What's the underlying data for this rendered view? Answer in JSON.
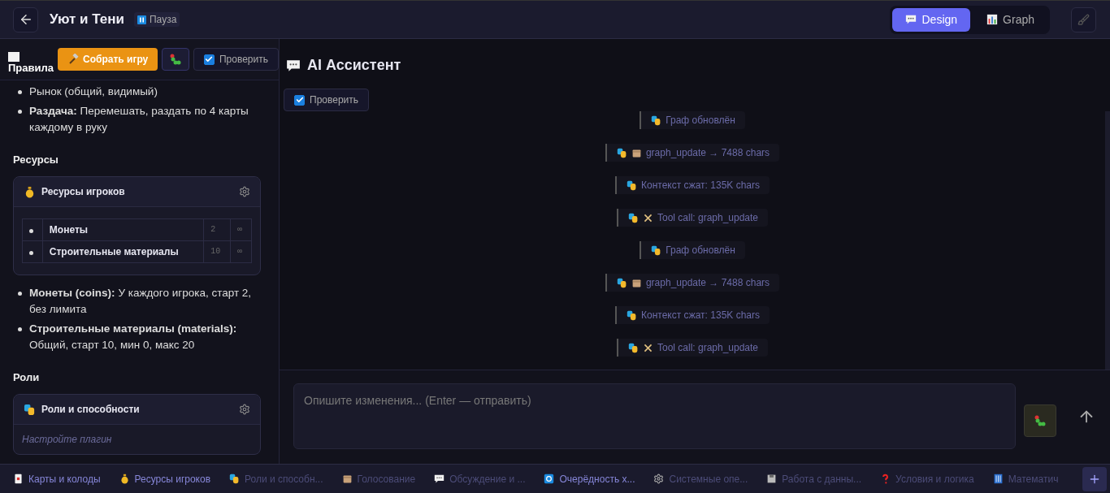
{
  "header": {
    "title": "Уют и Тени",
    "status": "Пауза",
    "modes": [
      {
        "label": "Design",
        "selected": true
      },
      {
        "label": "Graph",
        "selected": false
      }
    ]
  },
  "left": {
    "tab": "Правила",
    "build_button": "Собрать игру",
    "check": {
      "label": "Проверить",
      "checked": true
    },
    "top_bullets": [
      "Рынок (общий, видимый)",
      "**Раздача:** Перемешать, раздать по 4 карты каждому в руку"
    ],
    "sections": [
      {
        "heading": "Ресурсы",
        "card": {
          "kind": "resources",
          "title": "Ресурсы игроков",
          "rows": [
            {
              "name": "Монеты",
              "value": "2",
              "column_3": "∞"
            },
            {
              "name": "Строительные материалы",
              "value": "10",
              "column_3": "∞"
            }
          ]
        },
        "bullets": [
          "**Монеты (coins):** У каждого игрока, старт 2, без лимита",
          "**Строительные материалы (materials):** Общий, старт 10, мин 0, макс 20"
        ]
      },
      {
        "heading": "Роли",
        "card": {
          "kind": "roles",
          "title": "Роли и способности",
          "hint": "Настройте плагин"
        }
      }
    ]
  },
  "assistant": {
    "title": "AI Ассистент",
    "check": {
      "label": "Проверить",
      "checked": true
    },
    "log": [
      {
        "kind": "graph",
        "text": "Граф обновлён"
      },
      {
        "kind": "output",
        "text": "graph_update → 7488 chars"
      },
      {
        "kind": "context",
        "text": "Контекст сжат: 135K chars"
      },
      {
        "kind": "tool",
        "text": "Tool call: graph_update"
      },
      {
        "kind": "graph",
        "text": "Граф обновлён"
      },
      {
        "kind": "output",
        "text": "graph_update → 7488 chars"
      },
      {
        "kind": "context",
        "text": "Контекст сжат: 135K chars"
      },
      {
        "kind": "tool",
        "text": "Tool call: graph_update"
      }
    ],
    "input": {
      "placeholder": "Опишите изменения... (Enter — отправить)"
    }
  },
  "plugins": [
    {
      "kind": "cards",
      "label": "Карты и колоды",
      "active": true
    },
    {
      "kind": "resources",
      "label": "Ресурсы игроков",
      "active": true
    },
    {
      "kind": "roles",
      "label": "Роли и способн...",
      "active": false
    },
    {
      "kind": "voting",
      "label": "Голосование",
      "active": false
    },
    {
      "kind": "discussion",
      "label": "Обсуждение и ...",
      "active": false
    },
    {
      "kind": "turns",
      "label": "Очерёдность х...",
      "active": true
    },
    {
      "kind": "system",
      "label": "Системные опе...",
      "active": false
    },
    {
      "kind": "data",
      "label": "Работа с данны...",
      "active": false
    },
    {
      "kind": "logic",
      "label": "Условия и логика",
      "active": false
    },
    {
      "kind": "math",
      "label": "Математич",
      "active": false
    }
  ]
}
